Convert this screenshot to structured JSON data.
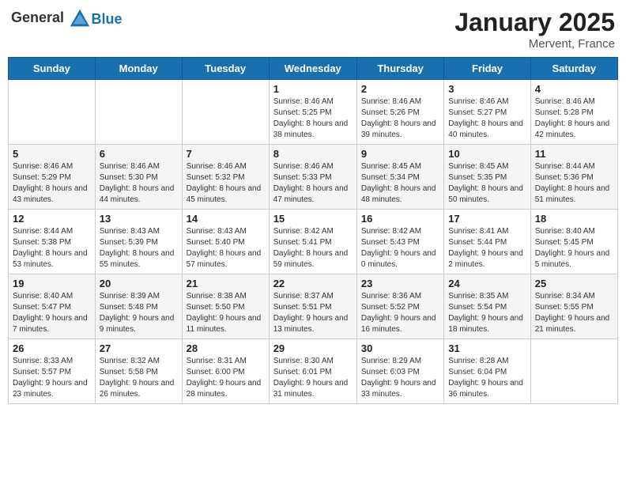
{
  "header": {
    "logo_general": "General",
    "logo_blue": "Blue",
    "month": "January 2025",
    "location": "Mervent, France"
  },
  "weekdays": [
    "Sunday",
    "Monday",
    "Tuesday",
    "Wednesday",
    "Thursday",
    "Friday",
    "Saturday"
  ],
  "weeks": [
    [
      {
        "day": "",
        "sunrise": "",
        "sunset": "",
        "daylight": ""
      },
      {
        "day": "",
        "sunrise": "",
        "sunset": "",
        "daylight": ""
      },
      {
        "day": "",
        "sunrise": "",
        "sunset": "",
        "daylight": ""
      },
      {
        "day": "1",
        "sunrise": "Sunrise: 8:46 AM",
        "sunset": "Sunset: 5:25 PM",
        "daylight": "Daylight: 8 hours and 38 minutes."
      },
      {
        "day": "2",
        "sunrise": "Sunrise: 8:46 AM",
        "sunset": "Sunset: 5:26 PM",
        "daylight": "Daylight: 8 hours and 39 minutes."
      },
      {
        "day": "3",
        "sunrise": "Sunrise: 8:46 AM",
        "sunset": "Sunset: 5:27 PM",
        "daylight": "Daylight: 8 hours and 40 minutes."
      },
      {
        "day": "4",
        "sunrise": "Sunrise: 8:46 AM",
        "sunset": "Sunset: 5:28 PM",
        "daylight": "Daylight: 8 hours and 42 minutes."
      }
    ],
    [
      {
        "day": "5",
        "sunrise": "Sunrise: 8:46 AM",
        "sunset": "Sunset: 5:29 PM",
        "daylight": "Daylight: 8 hours and 43 minutes."
      },
      {
        "day": "6",
        "sunrise": "Sunrise: 8:46 AM",
        "sunset": "Sunset: 5:30 PM",
        "daylight": "Daylight: 8 hours and 44 minutes."
      },
      {
        "day": "7",
        "sunrise": "Sunrise: 8:46 AM",
        "sunset": "Sunset: 5:32 PM",
        "daylight": "Daylight: 8 hours and 45 minutes."
      },
      {
        "day": "8",
        "sunrise": "Sunrise: 8:46 AM",
        "sunset": "Sunset: 5:33 PM",
        "daylight": "Daylight: 8 hours and 47 minutes."
      },
      {
        "day": "9",
        "sunrise": "Sunrise: 8:45 AM",
        "sunset": "Sunset: 5:34 PM",
        "daylight": "Daylight: 8 hours and 48 minutes."
      },
      {
        "day": "10",
        "sunrise": "Sunrise: 8:45 AM",
        "sunset": "Sunset: 5:35 PM",
        "daylight": "Daylight: 8 hours and 50 minutes."
      },
      {
        "day": "11",
        "sunrise": "Sunrise: 8:44 AM",
        "sunset": "Sunset: 5:36 PM",
        "daylight": "Daylight: 8 hours and 51 minutes."
      }
    ],
    [
      {
        "day": "12",
        "sunrise": "Sunrise: 8:44 AM",
        "sunset": "Sunset: 5:38 PM",
        "daylight": "Daylight: 8 hours and 53 minutes."
      },
      {
        "day": "13",
        "sunrise": "Sunrise: 8:43 AM",
        "sunset": "Sunset: 5:39 PM",
        "daylight": "Daylight: 8 hours and 55 minutes."
      },
      {
        "day": "14",
        "sunrise": "Sunrise: 8:43 AM",
        "sunset": "Sunset: 5:40 PM",
        "daylight": "Daylight: 8 hours and 57 minutes."
      },
      {
        "day": "15",
        "sunrise": "Sunrise: 8:42 AM",
        "sunset": "Sunset: 5:41 PM",
        "daylight": "Daylight: 8 hours and 59 minutes."
      },
      {
        "day": "16",
        "sunrise": "Sunrise: 8:42 AM",
        "sunset": "Sunset: 5:43 PM",
        "daylight": "Daylight: 9 hours and 0 minutes."
      },
      {
        "day": "17",
        "sunrise": "Sunrise: 8:41 AM",
        "sunset": "Sunset: 5:44 PM",
        "daylight": "Daylight: 9 hours and 2 minutes."
      },
      {
        "day": "18",
        "sunrise": "Sunrise: 8:40 AM",
        "sunset": "Sunset: 5:45 PM",
        "daylight": "Daylight: 9 hours and 5 minutes."
      }
    ],
    [
      {
        "day": "19",
        "sunrise": "Sunrise: 8:40 AM",
        "sunset": "Sunset: 5:47 PM",
        "daylight": "Daylight: 9 hours and 7 minutes."
      },
      {
        "day": "20",
        "sunrise": "Sunrise: 8:39 AM",
        "sunset": "Sunset: 5:48 PM",
        "daylight": "Daylight: 9 hours and 9 minutes."
      },
      {
        "day": "21",
        "sunrise": "Sunrise: 8:38 AM",
        "sunset": "Sunset: 5:50 PM",
        "daylight": "Daylight: 9 hours and 11 minutes."
      },
      {
        "day": "22",
        "sunrise": "Sunrise: 8:37 AM",
        "sunset": "Sunset: 5:51 PM",
        "daylight": "Daylight: 9 hours and 13 minutes."
      },
      {
        "day": "23",
        "sunrise": "Sunrise: 8:36 AM",
        "sunset": "Sunset: 5:52 PM",
        "daylight": "Daylight: 9 hours and 16 minutes."
      },
      {
        "day": "24",
        "sunrise": "Sunrise: 8:35 AM",
        "sunset": "Sunset: 5:54 PM",
        "daylight": "Daylight: 9 hours and 18 minutes."
      },
      {
        "day": "25",
        "sunrise": "Sunrise: 8:34 AM",
        "sunset": "Sunset: 5:55 PM",
        "daylight": "Daylight: 9 hours and 21 minutes."
      }
    ],
    [
      {
        "day": "26",
        "sunrise": "Sunrise: 8:33 AM",
        "sunset": "Sunset: 5:57 PM",
        "daylight": "Daylight: 9 hours and 23 minutes."
      },
      {
        "day": "27",
        "sunrise": "Sunrise: 8:32 AM",
        "sunset": "Sunset: 5:58 PM",
        "daylight": "Daylight: 9 hours and 26 minutes."
      },
      {
        "day": "28",
        "sunrise": "Sunrise: 8:31 AM",
        "sunset": "Sunset: 6:00 PM",
        "daylight": "Daylight: 9 hours and 28 minutes."
      },
      {
        "day": "29",
        "sunrise": "Sunrise: 8:30 AM",
        "sunset": "Sunset: 6:01 PM",
        "daylight": "Daylight: 9 hours and 31 minutes."
      },
      {
        "day": "30",
        "sunrise": "Sunrise: 8:29 AM",
        "sunset": "Sunset: 6:03 PM",
        "daylight": "Daylight: 9 hours and 33 minutes."
      },
      {
        "day": "31",
        "sunrise": "Sunrise: 8:28 AM",
        "sunset": "Sunset: 6:04 PM",
        "daylight": "Daylight: 9 hours and 36 minutes."
      },
      {
        "day": "",
        "sunrise": "",
        "sunset": "",
        "daylight": ""
      }
    ]
  ]
}
